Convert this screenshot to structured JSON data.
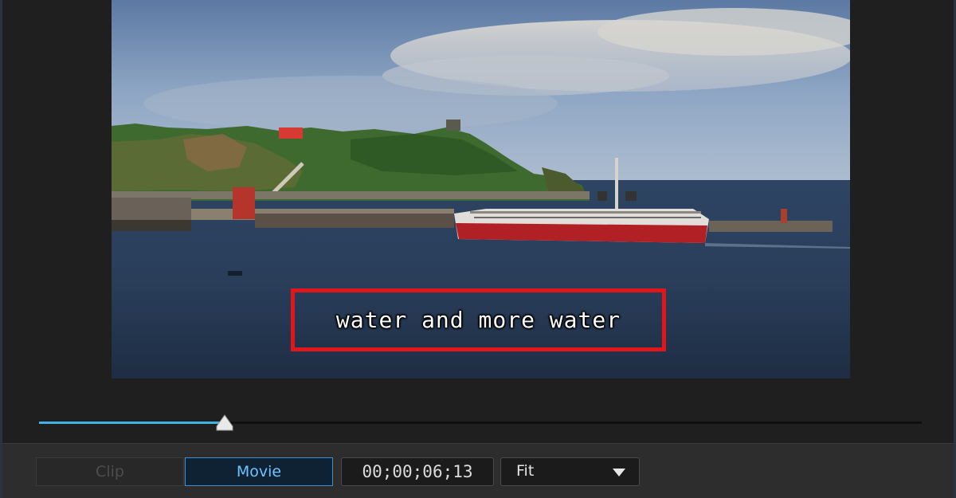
{
  "preview": {
    "subtitle": "water and more water"
  },
  "playback": {
    "progress": 0.21
  },
  "toolbar": {
    "clip_label": "Clip",
    "movie_label": "Movie",
    "mode_selected": "Movie",
    "timecode": "00;00;06;13",
    "fit_value": "Fit"
  },
  "colors": {
    "accent": "#3fb2e3",
    "highlight_border": "#e0161b"
  },
  "icons": {
    "playhead": "triangle-up-icon",
    "dropdown": "chevron-down-icon"
  }
}
